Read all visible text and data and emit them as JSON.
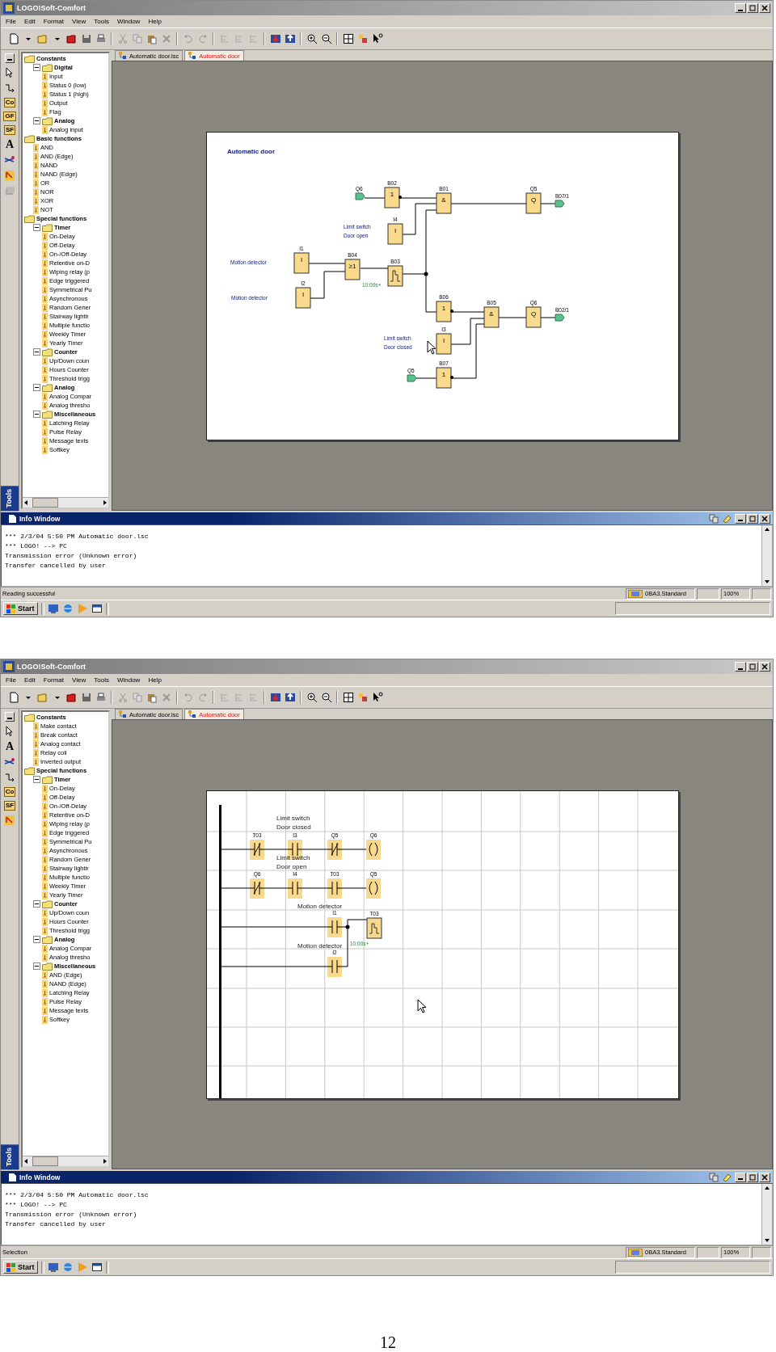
{
  "screens": [
    {
      "window": {
        "title": "LOGO!Soft-Comfort"
      },
      "menu": [
        "File",
        "Edit",
        "Format",
        "View",
        "Tools",
        "Window",
        "Help"
      ],
      "tools": [
        {
          "kind": "select"
        },
        {
          "kind": "connect"
        },
        {
          "kind": "label",
          "label": "Co"
        },
        {
          "kind": "label",
          "label": "GF"
        },
        {
          "kind": "label",
          "label": "SF"
        },
        {
          "kind": "text",
          "label": "A"
        },
        {
          "kind": "cut"
        },
        {
          "kind": "network"
        },
        {
          "kind": "stack"
        }
      ],
      "tools_title": "Tools",
      "tree": [
        {
          "label": "Constants",
          "children": [
            {
              "label": "Digital",
              "expanded": true,
              "children": [
                {
                  "label": "Input"
                },
                {
                  "label": "Status 0 (low)"
                },
                {
                  "label": "Status 1 (high)"
                },
                {
                  "label": "Output"
                },
                {
                  "label": "Flag"
                }
              ]
            },
            {
              "label": "Analog",
              "expanded": true,
              "children": [
                {
                  "label": "Analog input"
                }
              ]
            }
          ]
        },
        {
          "label": "Basic functions",
          "children": [
            {
              "label": "AND"
            },
            {
              "label": "AND (Edge)"
            },
            {
              "label": "NAND"
            },
            {
              "label": "NAND (Edge)"
            },
            {
              "label": "OR"
            },
            {
              "label": "NOR"
            },
            {
              "label": "XOR"
            },
            {
              "label": "NOT"
            }
          ]
        },
        {
          "label": "Special functions",
          "children": [
            {
              "label": "Timer",
              "expanded": true,
              "children": [
                {
                  "label": "On-Delay"
                },
                {
                  "label": "Off-Delay"
                },
                {
                  "label": "On-/Off-Delay"
                },
                {
                  "label": "Retentive on-D"
                },
                {
                  "label": "Wiping relay (p"
                },
                {
                  "label": "Edge triggered"
                },
                {
                  "label": "Symmetrical Pu"
                },
                {
                  "label": "Asynchronous"
                },
                {
                  "label": "Random Gener"
                },
                {
                  "label": "Stairway lightir"
                },
                {
                  "label": "Multiple functio"
                },
                {
                  "label": "Weekly Timer"
                },
                {
                  "label": "Yearly Timer"
                }
              ]
            },
            {
              "label": "Counter",
              "expanded": true,
              "children": [
                {
                  "label": "Up/Down coun"
                },
                {
                  "label": "Hours Counter"
                },
                {
                  "label": "Threshold trigg"
                }
              ]
            },
            {
              "label": "Analog",
              "expanded": true,
              "children": [
                {
                  "label": "Analog Compar"
                },
                {
                  "label": "Analog thresho"
                }
              ]
            },
            {
              "label": "Miscellaneous",
              "expanded": true,
              "children": [
                {
                  "label": "Latching Relay"
                },
                {
                  "label": "Pulse Relay"
                },
                {
                  "label": "Message texts"
                },
                {
                  "label": "Softkey"
                }
              ]
            }
          ]
        }
      ],
      "tabs": [
        {
          "label": "Automatic door.lsc",
          "selected": false
        },
        {
          "label": "Automatic door",
          "selected": true
        }
      ],
      "diagram": {
        "kind": "fbd",
        "title": "Automatic door",
        "elements": [
          {
            "kind": "flag",
            "label": "Q6"
          },
          {
            "kind": "block",
            "label": "B02",
            "symbol": "1",
            "negated": true
          },
          {
            "kind": "block",
            "label": "B01",
            "symbol": "&",
            "negated": false
          },
          {
            "kind": "block",
            "label": "Q5",
            "symbol": "Q",
            "negated": false
          },
          {
            "kind": "flag",
            "label": "B07/1"
          },
          {
            "kind": "block",
            "label": "I4",
            "symbol": "I",
            "negated": false
          },
          {
            "kind": "block",
            "label": "I1",
            "symbol": "I",
            "negated": false
          },
          {
            "kind": "block",
            "label": "B04",
            "symbol": "≥1",
            "negated": false
          },
          {
            "kind": "timer",
            "label": "B03",
            "parameter": "10:00s+"
          },
          {
            "kind": "block",
            "label": "I2",
            "symbol": "I",
            "negated": false
          },
          {
            "kind": "block",
            "label": "B06",
            "symbol": "1",
            "negated": true
          },
          {
            "kind": "block",
            "label": "B05",
            "symbol": "&",
            "negated": false
          },
          {
            "kind": "block",
            "label": "Q6",
            "symbol": "Q",
            "negated": false
          },
          {
            "kind": "flag",
            "label": "B02/1"
          },
          {
            "kind": "block",
            "label": "I3",
            "symbol": "I",
            "negated": false
          },
          {
            "kind": "block",
            "label": "B07",
            "symbol": "1",
            "negated": true
          },
          {
            "kind": "flag",
            "label": "Q5"
          }
        ],
        "comments": [
          [
            "Limit switch",
            "Door open"
          ],
          [
            "Motion detector"
          ],
          [
            "Motion detector"
          ],
          [
            "Limit switch",
            "Door closed"
          ]
        ]
      },
      "info_window": {
        "title": "Info Window",
        "lines": [
          "*** 2/3/04 5:50 PM Automatic door.lsc",
          "*** LOGO! --> PC",
          "Transmission error (Unknown error)",
          "Transfer cancelled by user"
        ]
      },
      "status_bar": {
        "message": "Reading successful",
        "device": "0BA3.Standard",
        "zoom": "100%"
      },
      "taskbar": {
        "start": "Start"
      }
    },
    {
      "window": {
        "title": "LOGO!Soft-Comfort"
      },
      "menu": [
        "File",
        "Edit",
        "Format",
        "View",
        "Tools",
        "Window",
        "Help"
      ],
      "tools": [
        {
          "kind": "select"
        },
        {
          "kind": "text",
          "label": "A"
        },
        {
          "kind": "cut"
        },
        {
          "kind": "connect"
        },
        {
          "kind": "label",
          "label": "Co"
        },
        {
          "kind": "label",
          "label": "SF"
        },
        {
          "kind": "network"
        }
      ],
      "tools_title": "Tools",
      "tree": [
        {
          "label": "Constants",
          "children": [
            {
              "label": "Make contact"
            },
            {
              "label": "Break contact"
            },
            {
              "label": "Analog contact"
            },
            {
              "label": "Relay coil"
            },
            {
              "label": "Inverted output"
            }
          ]
        },
        {
          "label": "Special functions",
          "children": [
            {
              "label": "Timer",
              "expanded": true,
              "children": [
                {
                  "label": "On-Delay"
                },
                {
                  "label": "Off-Delay"
                },
                {
                  "label": "On-/Off-Delay"
                },
                {
                  "label": "Retentive on-D"
                },
                {
                  "label": "Wiping relay (p"
                },
                {
                  "label": "Edge triggered"
                },
                {
                  "label": "Symmetrical Pu"
                },
                {
                  "label": "Asynchronous"
                },
                {
                  "label": "Random Gener"
                },
                {
                  "label": "Stairway lightir"
                },
                {
                  "label": "Multiple functio"
                },
                {
                  "label": "Weekly Timer"
                },
                {
                  "label": "Yearly Timer"
                }
              ]
            },
            {
              "label": "Counter",
              "expanded": true,
              "children": [
                {
                  "label": "Up/Down coun"
                },
                {
                  "label": "Hours Counter"
                },
                {
                  "label": "Threshold trigg"
                }
              ]
            },
            {
              "label": "Analog",
              "expanded": true,
              "children": [
                {
                  "label": "Analog Compar"
                },
                {
                  "label": "Analog thresho"
                }
              ]
            },
            {
              "label": "Miscellaneous",
              "expanded": true,
              "children": [
                {
                  "label": "AND (Edge)"
                },
                {
                  "label": "NAND (Edge)"
                },
                {
                  "label": "Latching Relay"
                },
                {
                  "label": "Pulse Relay"
                },
                {
                  "label": "Message texts"
                },
                {
                  "label": "Softkey"
                }
              ]
            }
          ]
        }
      ],
      "tabs": [
        {
          "label": "Automatic door.lsc",
          "selected": false
        },
        {
          "label": "Automatic door",
          "selected": true
        }
      ],
      "diagram": {
        "kind": "ladder",
        "elements": [
          {
            "kind": "nc",
            "label": "T03"
          },
          {
            "kind": "no",
            "label": "I3"
          },
          {
            "kind": "nc",
            "label": "Q5"
          },
          {
            "kind": "coil",
            "label": "Q6"
          },
          {
            "kind": "nc",
            "label": "Q6"
          },
          {
            "kind": "no",
            "label": "I4"
          },
          {
            "kind": "no",
            "label": "T03"
          },
          {
            "kind": "coil",
            "label": "Q5"
          },
          {
            "kind": "no",
            "label": "I1"
          },
          {
            "kind": "timer",
            "label": "T03",
            "parameter": "10:00s+"
          },
          {
            "kind": "no",
            "label": "I2"
          }
        ],
        "comments": [
          [
            "Limit switch",
            "Door closed"
          ],
          [
            "Limit switch",
            "Door open"
          ],
          [
            "Motion detector"
          ],
          [
            "Motion detector"
          ]
        ]
      },
      "info_window": {
        "title": "Info Window",
        "lines": [
          "*** 2/3/04 5:50 PM Automatic door.lsc",
          "*** LOGO! --> PC",
          "Transmission error (Unknown error)",
          "Transfer cancelled by user"
        ]
      },
      "status_bar": {
        "message": "Selection",
        "device": "0BA3.Standard",
        "zoom": "100%"
      },
      "taskbar": {
        "start": "Start"
      }
    }
  ],
  "page_number": "12"
}
